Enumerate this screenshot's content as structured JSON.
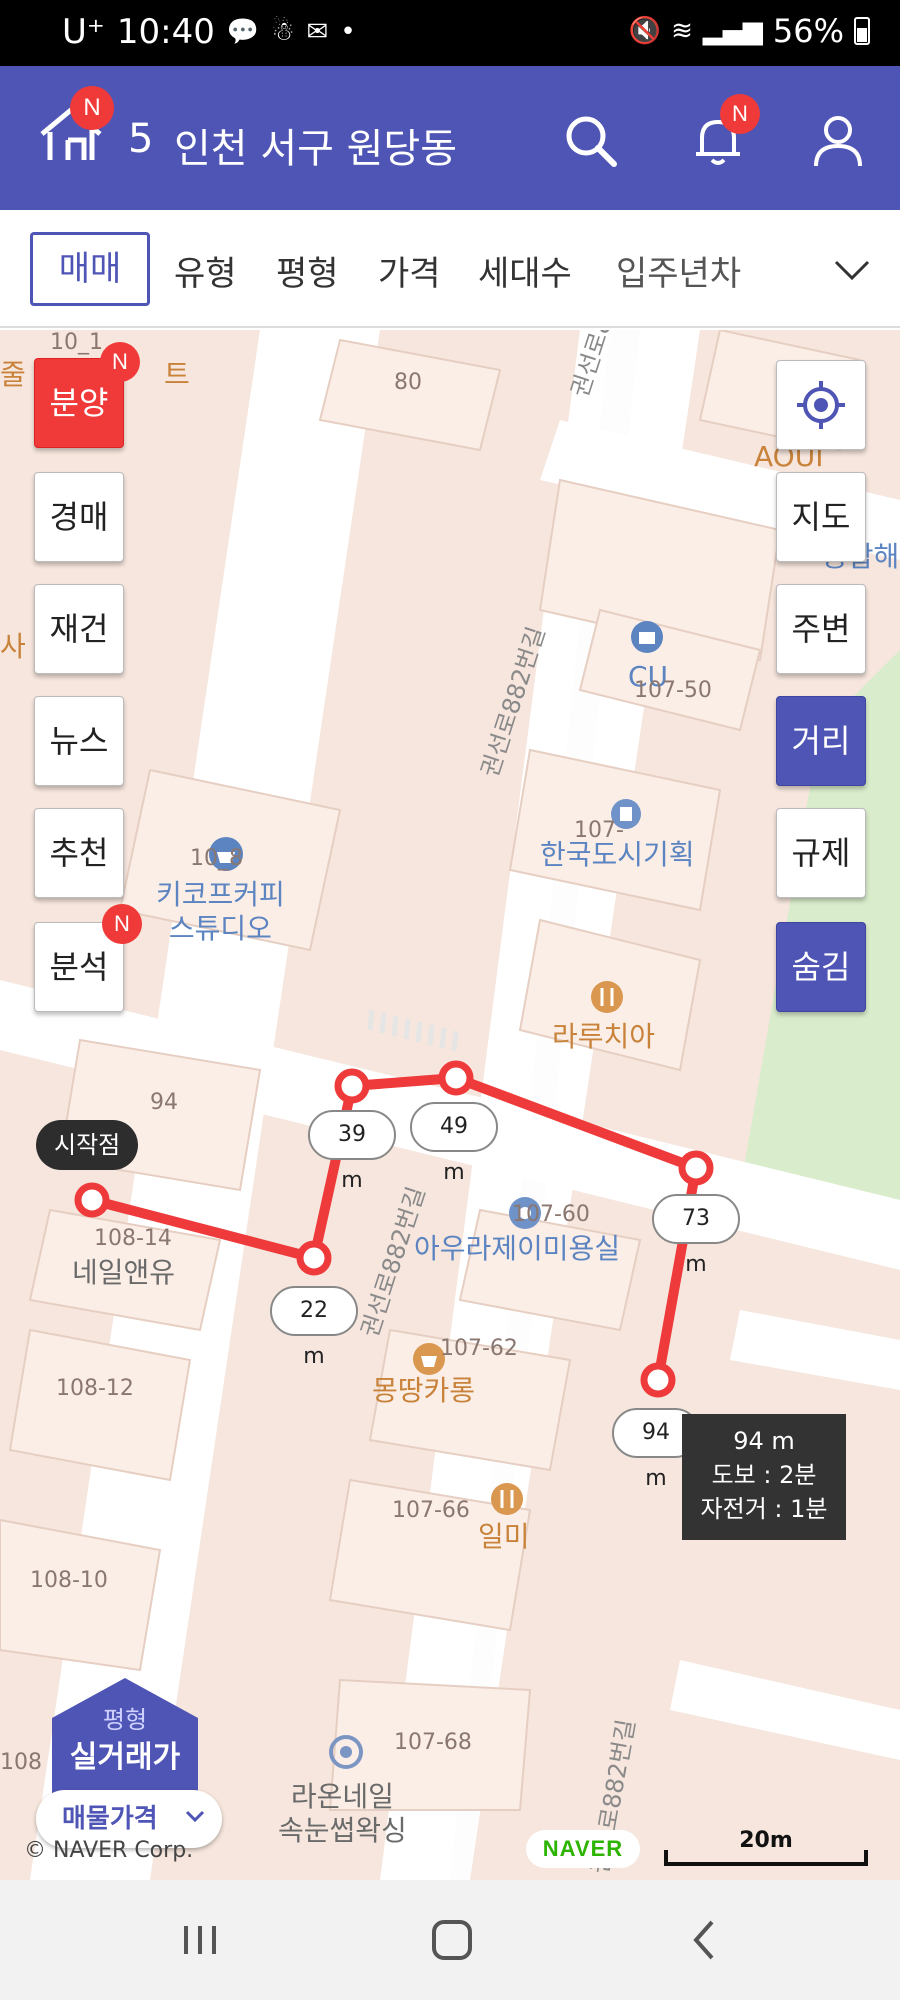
{
  "status_bar": {
    "carrier": "U⁺",
    "time": "10:40",
    "battery": "56%"
  },
  "header": {
    "location_count": "5",
    "location": "인천 서구 원당동",
    "badge": "N"
  },
  "filters": {
    "active": "매매",
    "items": [
      "유형",
      "평형",
      "가격",
      "세대수",
      "입주년차"
    ]
  },
  "left_buttons": [
    {
      "label": "분양",
      "badge": "N"
    },
    {
      "label": "경매"
    },
    {
      "label": "재건"
    },
    {
      "label": "뉴스"
    },
    {
      "label": "추천"
    },
    {
      "label": "분석",
      "badge": "N"
    }
  ],
  "right_buttons": [
    "지도",
    "주변",
    "거리",
    "규제",
    "숨김"
  ],
  "map": {
    "roads": [
      "권선로882번길",
      "권선로882번길",
      "권선로882번길",
      "권선로882번길"
    ],
    "pois": {
      "cu": "CU",
      "lot_107_50": "107-50",
      "hankook": "한국도시기획",
      "lot_107_x": "107-",
      "kiko_num": "10_8",
      "kiko": "키코프커피\n스튜디오",
      "laruchia": "라루치아",
      "aura_num": "107-60",
      "aura": "아우라제이미용실",
      "neil_num": "108-14",
      "neil": "네일앤유",
      "mong_num": "107-62",
      "mong": "몽땅카롱",
      "ilmi_num": "107-66",
      "ilmi": "일미",
      "laon_num": "107-68",
      "laon": "라온네일\n속눈썹왁싱",
      "top_num": "80",
      "b94": "94",
      "b108_12": "108-12",
      "b108_10": "108-10",
      "aoui": "AOUI",
      "partial_top": "10_1",
      "partial_jul": "줄",
      "partial_teu": "트",
      "partial_sa": "사",
      "partial_right": "공합해",
      "partial_108": "108"
    },
    "start_label": "시작점",
    "distances": [
      "22 m",
      "39 m",
      "49 m",
      "73 m",
      "94 m"
    ],
    "info": {
      "distance": "94 m",
      "walk": "도보 : 2분",
      "bike": "자전거 : 1분"
    },
    "house_top": "평형",
    "house_main": "실거래가",
    "price_pill": "매물가격",
    "copyright": "© NAVER Corp.",
    "naver": "NAVER",
    "scale": "20m"
  }
}
